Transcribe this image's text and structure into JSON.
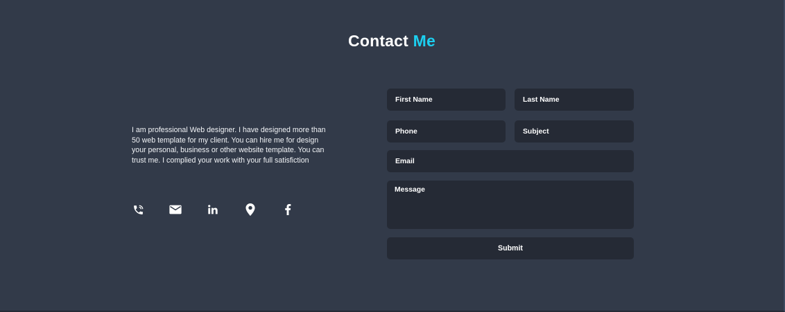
{
  "header": {
    "title_main": "Contact",
    "title_accent": "Me",
    "accent_color": "#1ccff0"
  },
  "intro": {
    "text": "I am professional Web designer. I have designed more than 50 web template for my client. You can hire me for design your personal, business or other website template. You can trust me. I complied your work with your full satisfiction"
  },
  "socials": [
    {
      "icon": "phone-icon"
    },
    {
      "icon": "mail-icon"
    },
    {
      "icon": "linkedin-icon"
    },
    {
      "icon": "location-pin-icon"
    },
    {
      "icon": "facebook-icon"
    }
  ],
  "form": {
    "first_name": {
      "placeholder": "First Name",
      "value": ""
    },
    "last_name": {
      "placeholder": "Last Name",
      "value": ""
    },
    "phone": {
      "placeholder": "Phone",
      "value": ""
    },
    "subject": {
      "placeholder": "Subject",
      "value": ""
    },
    "email": {
      "placeholder": "Email",
      "value": ""
    },
    "message": {
      "placeholder": "Message",
      "value": ""
    },
    "submit_label": "Submit"
  },
  "colors": {
    "background": "#323a49",
    "field_background": "#252a35",
    "text": "#ffffff"
  }
}
